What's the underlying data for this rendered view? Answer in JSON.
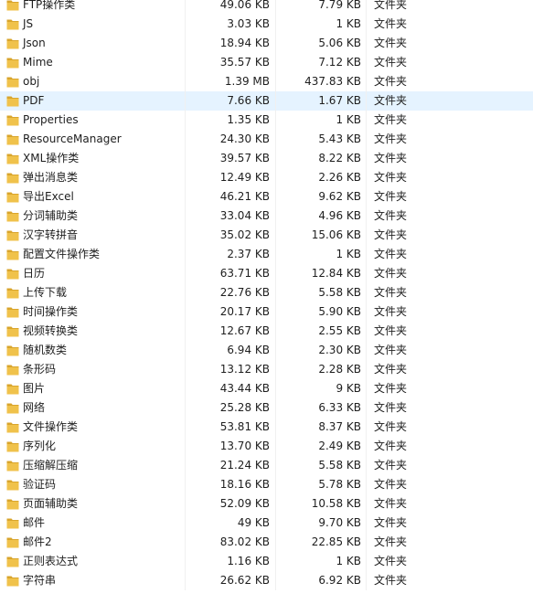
{
  "colors": {
    "folder": "#f0c24b",
    "folder_dark": "#d9a52c",
    "selected_row": "#e5f3ff",
    "text": "#1e1e1e"
  },
  "icon": "folder-icon",
  "rows": [
    {
      "name": "FTP操作类",
      "size": "49.06 KB",
      "packed": "7.79 KB",
      "type": "文件夹",
      "selected": false
    },
    {
      "name": "JS",
      "size": "3.03 KB",
      "packed": "1 KB",
      "type": "文件夹",
      "selected": false
    },
    {
      "name": "Json",
      "size": "18.94 KB",
      "packed": "5.06 KB",
      "type": "文件夹",
      "selected": false
    },
    {
      "name": "Mime",
      "size": "35.57 KB",
      "packed": "7.12 KB",
      "type": "文件夹",
      "selected": false
    },
    {
      "name": "obj",
      "size": "1.39 MB",
      "packed": "437.83 KB",
      "type": "文件夹",
      "selected": false
    },
    {
      "name": "PDF",
      "size": "7.66 KB",
      "packed": "1.67 KB",
      "type": "文件夹",
      "selected": true
    },
    {
      "name": "Properties",
      "size": "1.35 KB",
      "packed": "1 KB",
      "type": "文件夹",
      "selected": false
    },
    {
      "name": "ResourceManager",
      "size": "24.30 KB",
      "packed": "5.43 KB",
      "type": "文件夹",
      "selected": false
    },
    {
      "name": "XML操作类",
      "size": "39.57 KB",
      "packed": "8.22 KB",
      "type": "文件夹",
      "selected": false
    },
    {
      "name": "弹出消息类",
      "size": "12.49 KB",
      "packed": "2.26 KB",
      "type": "文件夹",
      "selected": false
    },
    {
      "name": "导出Excel",
      "size": "46.21 KB",
      "packed": "9.62 KB",
      "type": "文件夹",
      "selected": false
    },
    {
      "name": "分词辅助类",
      "size": "33.04 KB",
      "packed": "4.96 KB",
      "type": "文件夹",
      "selected": false
    },
    {
      "name": "汉字转拼音",
      "size": "35.02 KB",
      "packed": "15.06 KB",
      "type": "文件夹",
      "selected": false
    },
    {
      "name": "配置文件操作类",
      "size": "2.37 KB",
      "packed": "1 KB",
      "type": "文件夹",
      "selected": false
    },
    {
      "name": "日历",
      "size": "63.71 KB",
      "packed": "12.84 KB",
      "type": "文件夹",
      "selected": false
    },
    {
      "name": "上传下载",
      "size": "22.76 KB",
      "packed": "5.58 KB",
      "type": "文件夹",
      "selected": false
    },
    {
      "name": "时间操作类",
      "size": "20.17 KB",
      "packed": "5.90 KB",
      "type": "文件夹",
      "selected": false
    },
    {
      "name": "视频转换类",
      "size": "12.67 KB",
      "packed": "2.55 KB",
      "type": "文件夹",
      "selected": false
    },
    {
      "name": "随机数类",
      "size": "6.94 KB",
      "packed": "2.30 KB",
      "type": "文件夹",
      "selected": false
    },
    {
      "name": "条形码",
      "size": "13.12 KB",
      "packed": "2.28 KB",
      "type": "文件夹",
      "selected": false
    },
    {
      "name": "图片",
      "size": "43.44 KB",
      "packed": "9 KB",
      "type": "文件夹",
      "selected": false
    },
    {
      "name": "网络",
      "size": "25.28 KB",
      "packed": "6.33 KB",
      "type": "文件夹",
      "selected": false
    },
    {
      "name": "文件操作类",
      "size": "53.81 KB",
      "packed": "8.37 KB",
      "type": "文件夹",
      "selected": false
    },
    {
      "name": "序列化",
      "size": "13.70 KB",
      "packed": "2.49 KB",
      "type": "文件夹",
      "selected": false
    },
    {
      "name": "压缩解压缩",
      "size": "21.24 KB",
      "packed": "5.58 KB",
      "type": "文件夹",
      "selected": false
    },
    {
      "name": "验证码",
      "size": "18.16 KB",
      "packed": "5.78 KB",
      "type": "文件夹",
      "selected": false
    },
    {
      "name": "页面辅助类",
      "size": "52.09 KB",
      "packed": "10.58 KB",
      "type": "文件夹",
      "selected": false
    },
    {
      "name": "邮件",
      "size": "49 KB",
      "packed": "9.70 KB",
      "type": "文件夹",
      "selected": false
    },
    {
      "name": "邮件2",
      "size": "83.02 KB",
      "packed": "22.85 KB",
      "type": "文件夹",
      "selected": false
    },
    {
      "name": "正则表达式",
      "size": "1.16 KB",
      "packed": "1 KB",
      "type": "文件夹",
      "selected": false
    },
    {
      "name": "字符串",
      "size": "26.62 KB",
      "packed": "6.92 KB",
      "type": "文件夹",
      "selected": false
    }
  ]
}
